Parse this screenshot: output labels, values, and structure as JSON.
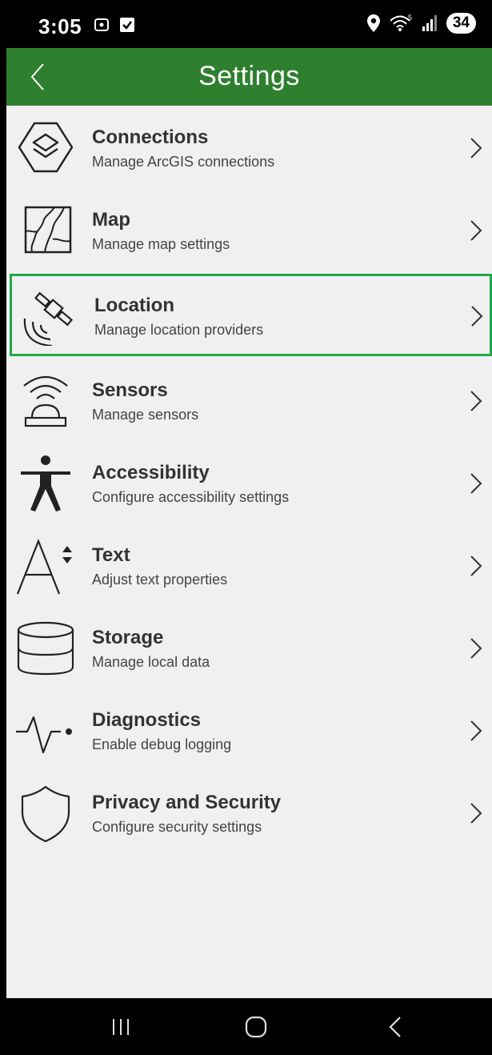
{
  "status_bar": {
    "time": "3:05",
    "battery": "34",
    "icons": [
      "screenshot-icon",
      "checkbox-notification-icon",
      "location-pin-icon",
      "wifi-icon",
      "signal-icon",
      "battery-icon"
    ]
  },
  "app_bar": {
    "title": "Settings",
    "back_icon": "chevron-left-icon",
    "background": "#2e7f2e"
  },
  "items": [
    {
      "title": "Connections",
      "subtitle": "Manage ArcGIS connections",
      "icon": "connections-icon"
    },
    {
      "title": "Map",
      "subtitle": "Manage map settings",
      "icon": "map-icon"
    },
    {
      "title": "Location",
      "subtitle": "Manage location providers",
      "icon": "satellite-icon",
      "selected": true
    },
    {
      "title": "Sensors",
      "subtitle": "Manage sensors",
      "icon": "sensor-icon"
    },
    {
      "title": "Accessibility",
      "subtitle": "Configure accessibility settings",
      "icon": "accessibility-icon"
    },
    {
      "title": "Text",
      "subtitle": "Adjust text properties",
      "icon": "text-size-icon"
    },
    {
      "title": "Storage",
      "subtitle": "Manage local data",
      "icon": "database-icon"
    },
    {
      "title": "Diagnostics",
      "subtitle": "Enable debug logging",
      "icon": "diagnostics-icon"
    },
    {
      "title": "Privacy and Security",
      "subtitle": "Configure security settings",
      "icon": "shield-icon"
    }
  ],
  "colors": {
    "selection_border": "#1fa84a",
    "content_background": "#f0f0f0"
  },
  "nav_bar": {
    "buttons": [
      "recent-apps-icon",
      "home-icon",
      "back-icon"
    ]
  }
}
